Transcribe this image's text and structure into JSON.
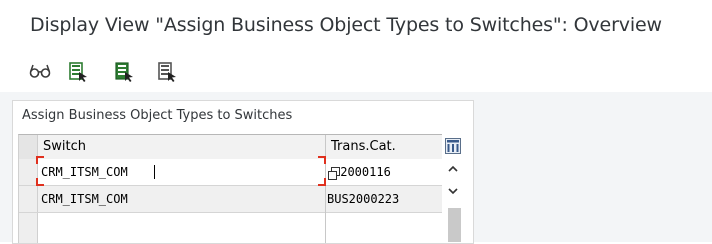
{
  "window": {
    "title": "Display View \"Assign Business Object Types to Switches\": Overview"
  },
  "toolbar": {
    "buttons": [
      {
        "icon": "glasses-icon",
        "label": ""
      },
      {
        "icon": "select-all-icon",
        "label": ""
      },
      {
        "icon": "select-block-icon",
        "label": ""
      },
      {
        "icon": "deselect-all-icon",
        "label": ""
      }
    ]
  },
  "table": {
    "title": "Assign Business Object Types to Switches",
    "columns": [
      "Switch",
      "Trans.Cat."
    ],
    "rows": [
      {
        "switch": "CRM_ITSM_COM",
        "trans_cat": "S2000116"
      },
      {
        "switch": "CRM_ITSM_COM",
        "trans_cat": "BUS2000223"
      },
      {
        "switch": "",
        "trans_cat": ""
      }
    ]
  },
  "colors": {
    "focus": "#e0301e",
    "accent_green": "#2e7d32",
    "header_bg": "#f2f2f2"
  }
}
